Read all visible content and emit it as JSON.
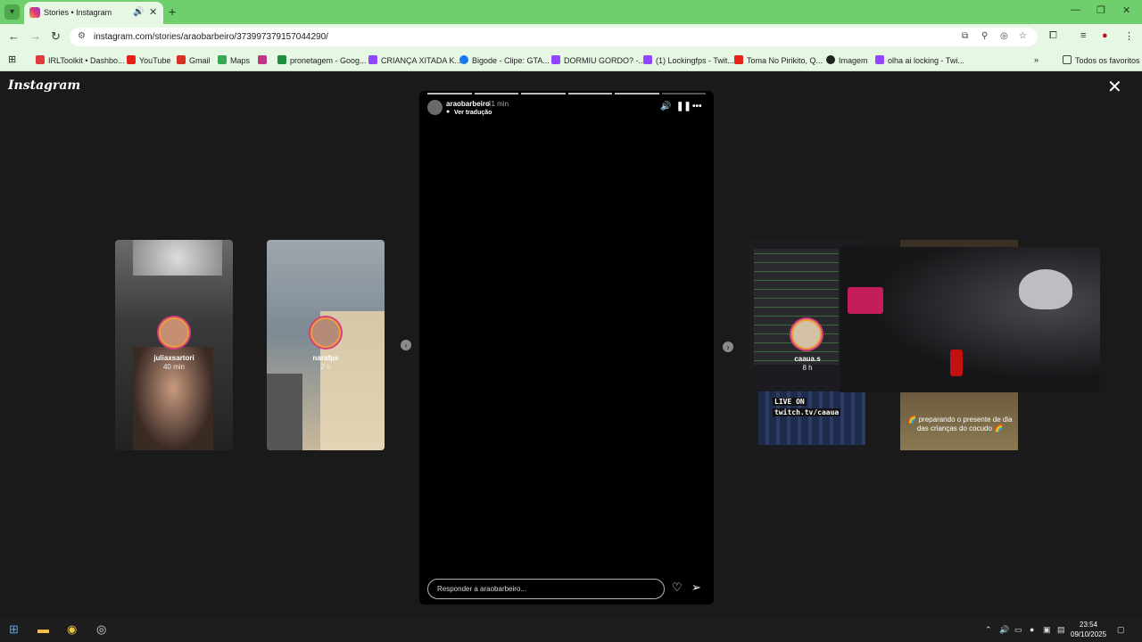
{
  "browser": {
    "tab_title": "Stories • Instagram",
    "tab_audio_icon": "speaker-icon",
    "url": "instagram.com/stories/araobarbeiro/3739973791570442​90/",
    "bookmarks": [
      {
        "label": "IRLToolkit • Dashbo...",
        "color": "#e23a3a"
      },
      {
        "label": "YouTube",
        "color": "#e62117"
      },
      {
        "label": "Gmail",
        "color": "#d93025"
      },
      {
        "label": "Maps",
        "color": "#34a853"
      },
      {
        "label": "",
        "color": "#c13584"
      },
      {
        "label": "pronetagem - Goog...",
        "color": "#1e8e3e"
      },
      {
        "label": "CRIANÇA XITADA K...",
        "color": "#9146ff"
      },
      {
        "label": "Bigode - Clipe: GTA...",
        "color": "#1877f2"
      },
      {
        "label": "DORMIU GORDO? -...",
        "color": "#9146ff"
      },
      {
        "label": "(1) Lockingfps - Twit...",
        "color": "#9146ff"
      },
      {
        "label": "Toma No Pirikito, Q...",
        "color": "#e62117"
      },
      {
        "label": "Imagem",
        "color": "#222222"
      },
      {
        "label": "olha ai locking - Twi...",
        "color": "#9146ff"
      }
    ],
    "all_bookmarks": "Todos os favoritos"
  },
  "page": {
    "logo": "Instagram",
    "previews_left": [
      {
        "user": "juliaxsartori",
        "time": "40 min"
      },
      {
        "user": "narafps",
        "time": "2 h"
      }
    ],
    "story": {
      "user": "araobarbeiro",
      "time": "41 min",
      "translate": "Ver tradução",
      "reply_placeholder": "Responder a araobarbeiro..."
    },
    "previews_right": {
      "user": "caaua.s",
      "time": "8 h",
      "live_line1": "LIVE ON",
      "live_line2": "twitch.tv/caaua",
      "gift_caption": "🌈 preparando o presente de dia das crianças do cocudo 🌈"
    }
  },
  "taskbar": {
    "time": "23:54",
    "date": "09/10/2025"
  }
}
